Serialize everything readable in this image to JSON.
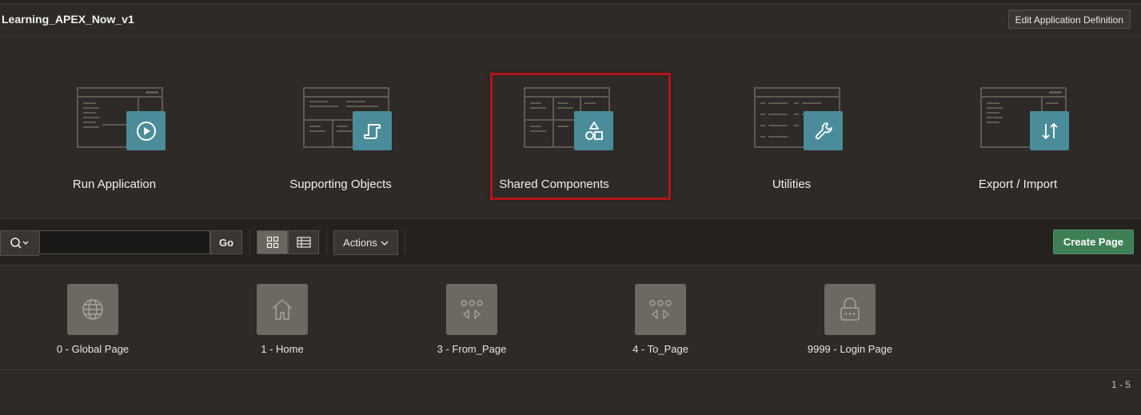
{
  "header": {
    "app_title": "Learning_APEX_Now_v1",
    "edit_button": "Edit Application Definition"
  },
  "tiles": [
    {
      "label": "Run Application",
      "icon": "play-icon",
      "selected": false
    },
    {
      "label": "Supporting Objects",
      "icon": "scroll-icon",
      "selected": false
    },
    {
      "label": "Shared Components",
      "icon": "shapes-icon",
      "selected": true
    },
    {
      "label": "Utilities",
      "icon": "wrench-icon",
      "selected": false
    },
    {
      "label": "Export / Import",
      "icon": "arrows-up-down-icon",
      "selected": false
    }
  ],
  "toolbar": {
    "search_value": "",
    "go_label": "Go",
    "actions_label": "Actions",
    "create_page_label": "Create Page"
  },
  "pages": [
    {
      "label": "0 - Global Page",
      "icon": "globe-icon"
    },
    {
      "label": "1 - Home",
      "icon": "home-icon"
    },
    {
      "label": "3 - From_Page",
      "icon": "carousel-icon"
    },
    {
      "label": "4 - To_Page",
      "icon": "carousel-icon"
    },
    {
      "label": "9999 - Login Page",
      "icon": "lock-icon"
    }
  ],
  "pagination": "1 - 5",
  "colors": {
    "accent": "#4b8c9a",
    "selection": "#b3151b",
    "create_button": "#3f7f56"
  }
}
